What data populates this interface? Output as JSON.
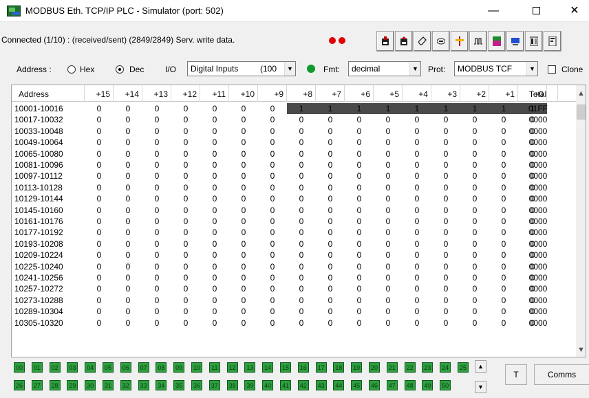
{
  "window": {
    "title": "MODBUS Eth. TCP/IP PLC - Simulator (port: 502)",
    "min_glyph": "—",
    "close_glyph": "✕"
  },
  "status": {
    "text": "Connected (1/10) : (received/sent) (2849/2849) Serv. write data.",
    "led_color": "#e00000"
  },
  "toolbar": {
    "icons": [
      "save-icon",
      "load-icon",
      "eraser-icon",
      "display-icon",
      "io-icon",
      "waveform-icon",
      "modbus-icon",
      "screen-icon",
      "panel-icon",
      "settings-icon"
    ]
  },
  "options": {
    "address_label": "Address :",
    "hex_label": "Hex",
    "dec_label": "Dec",
    "io_label": "I/O",
    "io_value": "Digital Inputs",
    "io_count": "(100",
    "fmt_label": "Fmt:",
    "fmt_value": "decimal",
    "prot_label": "Prot:",
    "prot_value": "MODBUS TCF",
    "clone_label": "Clone",
    "indicator_color": "#109a2c"
  },
  "grid": {
    "headers": [
      "Address",
      "+15",
      "+14",
      "+13",
      "+12",
      "+11",
      "+10",
      "+9",
      "+8",
      "+7",
      "+6",
      "+5",
      "+4",
      "+3",
      "+2",
      "+1",
      "+0",
      "Total"
    ],
    "rows": [
      {
        "address": "10001-10016",
        "bits": [
          0,
          0,
          0,
          0,
          0,
          0,
          0,
          1,
          1,
          1,
          1,
          1,
          1,
          1,
          1,
          1
        ],
        "total": "01FF"
      },
      {
        "address": "10017-10032",
        "bits": [
          0,
          0,
          0,
          0,
          0,
          0,
          0,
          0,
          0,
          0,
          0,
          0,
          0,
          0,
          0,
          0
        ],
        "total": "0000"
      },
      {
        "address": "10033-10048",
        "bits": [
          0,
          0,
          0,
          0,
          0,
          0,
          0,
          0,
          0,
          0,
          0,
          0,
          0,
          0,
          0,
          0
        ],
        "total": "0000"
      },
      {
        "address": "10049-10064",
        "bits": [
          0,
          0,
          0,
          0,
          0,
          0,
          0,
          0,
          0,
          0,
          0,
          0,
          0,
          0,
          0,
          0
        ],
        "total": "0000"
      },
      {
        "address": "10065-10080",
        "bits": [
          0,
          0,
          0,
          0,
          0,
          0,
          0,
          0,
          0,
          0,
          0,
          0,
          0,
          0,
          0,
          0
        ],
        "total": "0000"
      },
      {
        "address": "10081-10096",
        "bits": [
          0,
          0,
          0,
          0,
          0,
          0,
          0,
          0,
          0,
          0,
          0,
          0,
          0,
          0,
          0,
          0
        ],
        "total": "0000"
      },
      {
        "address": "10097-10112",
        "bits": [
          0,
          0,
          0,
          0,
          0,
          0,
          0,
          0,
          0,
          0,
          0,
          0,
          0,
          0,
          0,
          0
        ],
        "total": "0000"
      },
      {
        "address": "10113-10128",
        "bits": [
          0,
          0,
          0,
          0,
          0,
          0,
          0,
          0,
          0,
          0,
          0,
          0,
          0,
          0,
          0,
          0
        ],
        "total": "0000"
      },
      {
        "address": "10129-10144",
        "bits": [
          0,
          0,
          0,
          0,
          0,
          0,
          0,
          0,
          0,
          0,
          0,
          0,
          0,
          0,
          0,
          0
        ],
        "total": "0000"
      },
      {
        "address": "10145-10160",
        "bits": [
          0,
          0,
          0,
          0,
          0,
          0,
          0,
          0,
          0,
          0,
          0,
          0,
          0,
          0,
          0,
          0
        ],
        "total": "0000"
      },
      {
        "address": "10161-10176",
        "bits": [
          0,
          0,
          0,
          0,
          0,
          0,
          0,
          0,
          0,
          0,
          0,
          0,
          0,
          0,
          0,
          0
        ],
        "total": "0000"
      },
      {
        "address": "10177-10192",
        "bits": [
          0,
          0,
          0,
          0,
          0,
          0,
          0,
          0,
          0,
          0,
          0,
          0,
          0,
          0,
          0,
          0
        ],
        "total": "0000"
      },
      {
        "address": "10193-10208",
        "bits": [
          0,
          0,
          0,
          0,
          0,
          0,
          0,
          0,
          0,
          0,
          0,
          0,
          0,
          0,
          0,
          0
        ],
        "total": "0000"
      },
      {
        "address": "10209-10224",
        "bits": [
          0,
          0,
          0,
          0,
          0,
          0,
          0,
          0,
          0,
          0,
          0,
          0,
          0,
          0,
          0,
          0
        ],
        "total": "0000"
      },
      {
        "address": "10225-10240",
        "bits": [
          0,
          0,
          0,
          0,
          0,
          0,
          0,
          0,
          0,
          0,
          0,
          0,
          0,
          0,
          0,
          0
        ],
        "total": "0000"
      },
      {
        "address": "10241-10256",
        "bits": [
          0,
          0,
          0,
          0,
          0,
          0,
          0,
          0,
          0,
          0,
          0,
          0,
          0,
          0,
          0,
          0
        ],
        "total": "0000"
      },
      {
        "address": "10257-10272",
        "bits": [
          0,
          0,
          0,
          0,
          0,
          0,
          0,
          0,
          0,
          0,
          0,
          0,
          0,
          0,
          0,
          0
        ],
        "total": "0000"
      },
      {
        "address": "10273-10288",
        "bits": [
          0,
          0,
          0,
          0,
          0,
          0,
          0,
          0,
          0,
          0,
          0,
          0,
          0,
          0,
          0,
          0
        ],
        "total": "0000"
      },
      {
        "address": "10289-10304",
        "bits": [
          0,
          0,
          0,
          0,
          0,
          0,
          0,
          0,
          0,
          0,
          0,
          0,
          0,
          0,
          0,
          0
        ],
        "total": "0000"
      },
      {
        "address": "10305-10320",
        "bits": [
          0,
          0,
          0,
          0,
          0,
          0,
          0,
          0,
          0,
          0,
          0,
          0,
          0,
          0,
          0,
          0
        ],
        "total": "0000"
      }
    ],
    "active_cell_color": "#4a4a4a"
  },
  "coils": {
    "row1": [
      "00",
      "01",
      "02",
      "03",
      "04",
      "05",
      "06",
      "07",
      "08",
      "09",
      "10",
      "11",
      "12",
      "13",
      "14",
      "15",
      "16",
      "17",
      "18",
      "19",
      "20",
      "21",
      "22",
      "23",
      "24",
      "25"
    ],
    "row2": [
      "26",
      "27",
      "28",
      "29",
      "30",
      "31",
      "32",
      "33",
      "34",
      "35",
      "36",
      "37",
      "38",
      "39",
      "40",
      "41",
      "42",
      "43",
      "44",
      "45",
      "46",
      "47",
      "48",
      "49",
      "50"
    ],
    "color": "#2e9e3f"
  },
  "buttons": {
    "t_label": "T",
    "comms_label": "Comms",
    "spin_up": "▲",
    "spin_down": "▼"
  }
}
